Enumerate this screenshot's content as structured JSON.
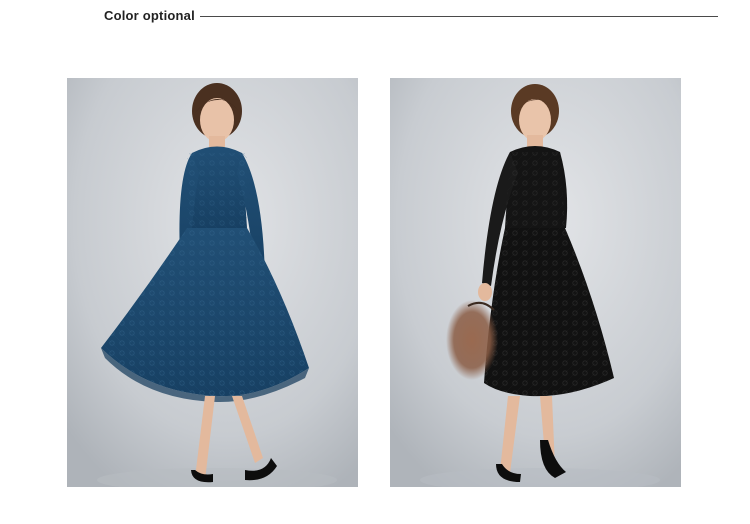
{
  "header": {
    "title": "Color optional"
  },
  "colors": {
    "title_text": "#222222",
    "rule": "#4a4a4a",
    "dress_blue": "#1d4a6e",
    "dress_black": "#111111",
    "backdrop": "#c9cdd1"
  },
  "gallery": {
    "items": [
      {
        "icon": "blue-lace-dress-photo"
      },
      {
        "icon": "black-lace-dress-photo"
      }
    ]
  }
}
